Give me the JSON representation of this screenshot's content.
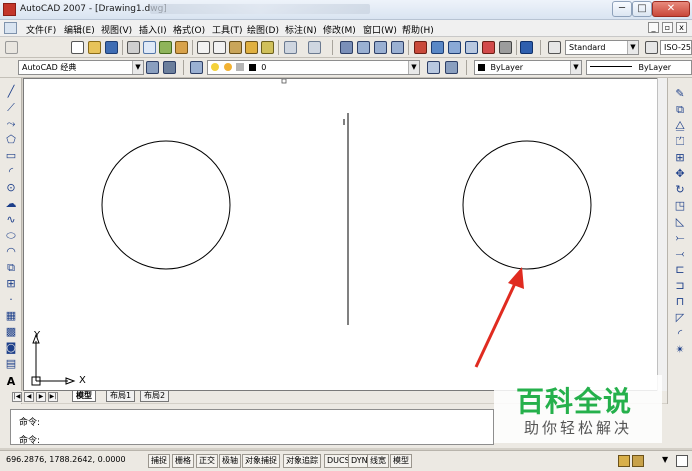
{
  "window": {
    "title": "AutoCAD 2007 - [Drawing1.dwg]",
    "min_glyph": "─",
    "max_glyph": "□",
    "close_glyph": "✕"
  },
  "menu": {
    "items": [
      "文件(F)",
      "编辑(E)",
      "视图(V)",
      "插入(I)",
      "格式(O)",
      "工具(T)",
      "绘图(D)",
      "标注(N)",
      "修改(M)",
      "窗口(W)",
      "帮助(H)"
    ],
    "doc_min": "_",
    "doc_restore": "▫",
    "doc_close": "x"
  },
  "toolbar": {
    "text_style": "Standard",
    "dim_style": "ISO-25",
    "workspace": "AutoCAD 经典",
    "layer": "0",
    "color": "ByLayer",
    "linetype": "ByLayer"
  },
  "canvas": {
    "ucs_x": "X",
    "ucs_y": "Y"
  },
  "tabs": [
    "模型",
    "布局1",
    "布局2"
  ],
  "command": {
    "line1": "命令:",
    "line2": "命令:"
  },
  "status": {
    "coords": "696.2876,  1788.2642, 0.0000",
    "buttons": [
      "捕捉",
      "栅格",
      "正交",
      "极轴",
      "对象捕捉",
      "对象追踪",
      "DUCS",
      "DYN",
      "线宽",
      "模型"
    ]
  },
  "watermark": {
    "title": "百科全说",
    "subtitle": "助你轻松解决"
  },
  "colors": {
    "watermark_green": "#25b04b",
    "arrow_red": "#e02b20"
  }
}
